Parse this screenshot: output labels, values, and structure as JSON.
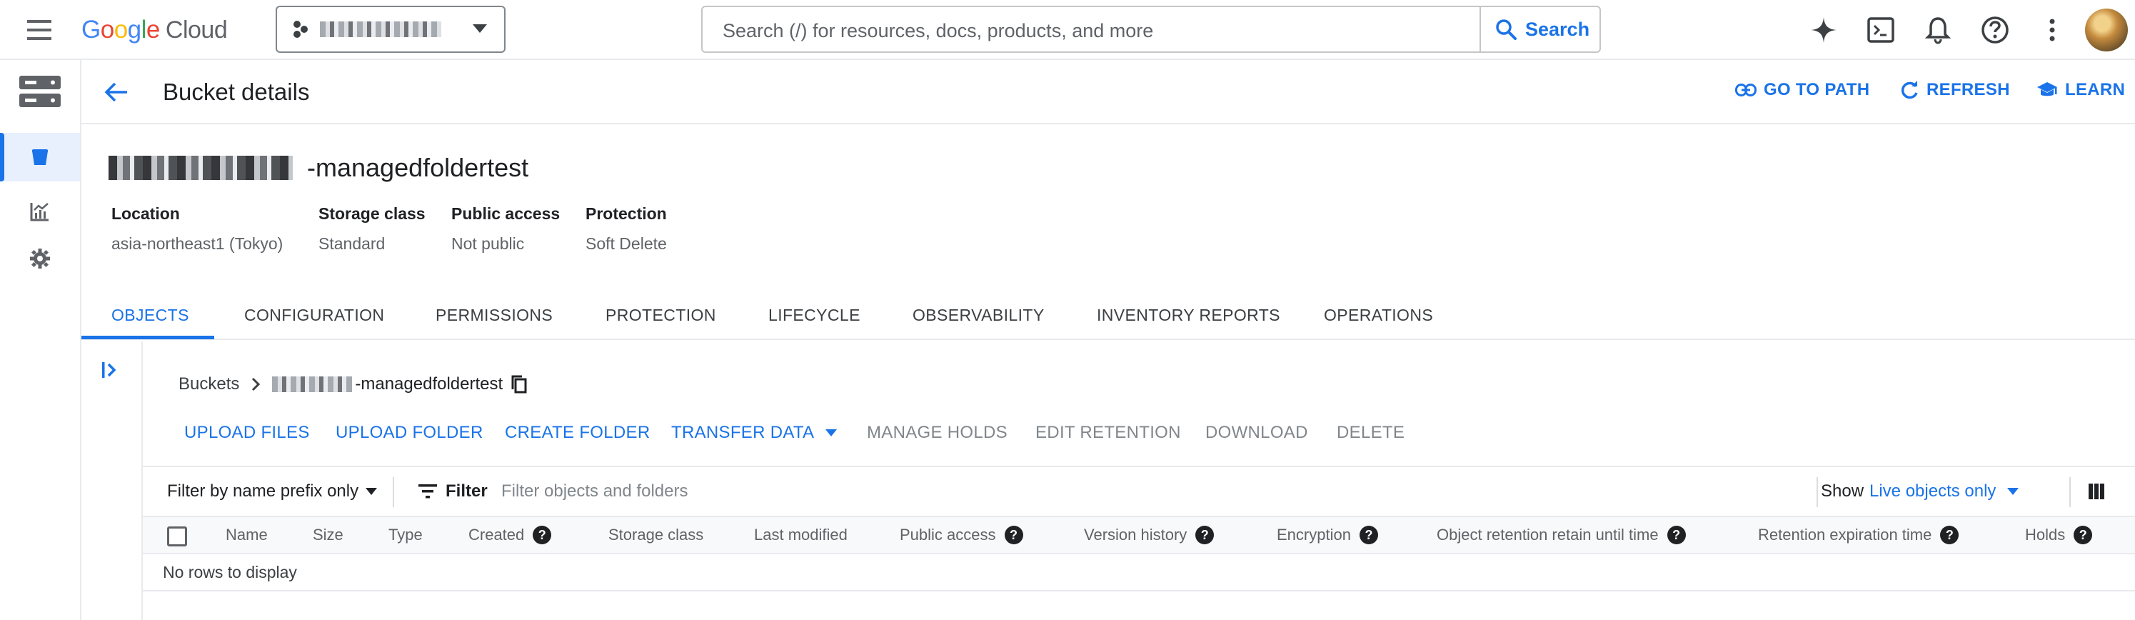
{
  "topbar": {
    "logo_google": "Google",
    "logo_cloud": "Cloud",
    "search_placeholder": "Search (/) for resources, docs, products, and more",
    "search_button": "Search"
  },
  "header": {
    "title": "Bucket details",
    "go_to_path": "GO TO PATH",
    "refresh": "REFRESH",
    "learn": "LEARN"
  },
  "bucket": {
    "name_suffix": "-managedfoldertest",
    "meta": [
      {
        "label": "Location",
        "value": "asia-northeast1 (Tokyo)"
      },
      {
        "label": "Storage class",
        "value": "Standard"
      },
      {
        "label": "Public access",
        "value": "Not public"
      },
      {
        "label": "Protection",
        "value": "Soft Delete"
      }
    ]
  },
  "tabs": [
    "OBJECTS",
    "CONFIGURATION",
    "PERMISSIONS",
    "PROTECTION",
    "LIFECYCLE",
    "OBSERVABILITY",
    "INVENTORY REPORTS",
    "OPERATIONS"
  ],
  "active_tab": "OBJECTS",
  "breadcrumb": {
    "root": "Buckets",
    "bucket_suffix": "-managedfoldertest"
  },
  "actions": {
    "upload_files": "UPLOAD FILES",
    "upload_folder": "UPLOAD FOLDER",
    "create_folder": "CREATE FOLDER",
    "transfer_data": "TRANSFER DATA",
    "manage_holds": "MANAGE HOLDS",
    "edit_retention": "EDIT RETENTION",
    "download": "DOWNLOAD",
    "delete": "DELETE"
  },
  "filter": {
    "mode": "Filter by name prefix only",
    "label": "Filter",
    "placeholder": "Filter objects and folders",
    "show_label": "Show",
    "show_value": "Live objects only"
  },
  "table": {
    "columns": [
      "Name",
      "Size",
      "Type",
      "Created",
      "Storage class",
      "Last modified",
      "Public access",
      "Version history",
      "Encryption",
      "Object retention retain until time",
      "Retention expiration time",
      "Holds"
    ],
    "empty_message": "No rows to display"
  },
  "colors": {
    "accent": "#1a73e8",
    "text": "#202124",
    "muted": "#5f6368",
    "divider": "#e8eaed"
  },
  "icons": [
    "hamburger-icon",
    "chevron-down-icon",
    "search-icon",
    "gemini-sparkle-icon",
    "terminal-icon",
    "bell-icon",
    "help-icon",
    "more-vert-icon",
    "storage-icon",
    "bucket-icon",
    "monitoring-icon",
    "settings-icon",
    "arrow-back-icon",
    "link-icon",
    "refresh-icon",
    "learn-icon",
    "panel-expand-icon",
    "chevron-right-icon",
    "copy-icon",
    "filter-icon",
    "column-display-icon"
  ]
}
